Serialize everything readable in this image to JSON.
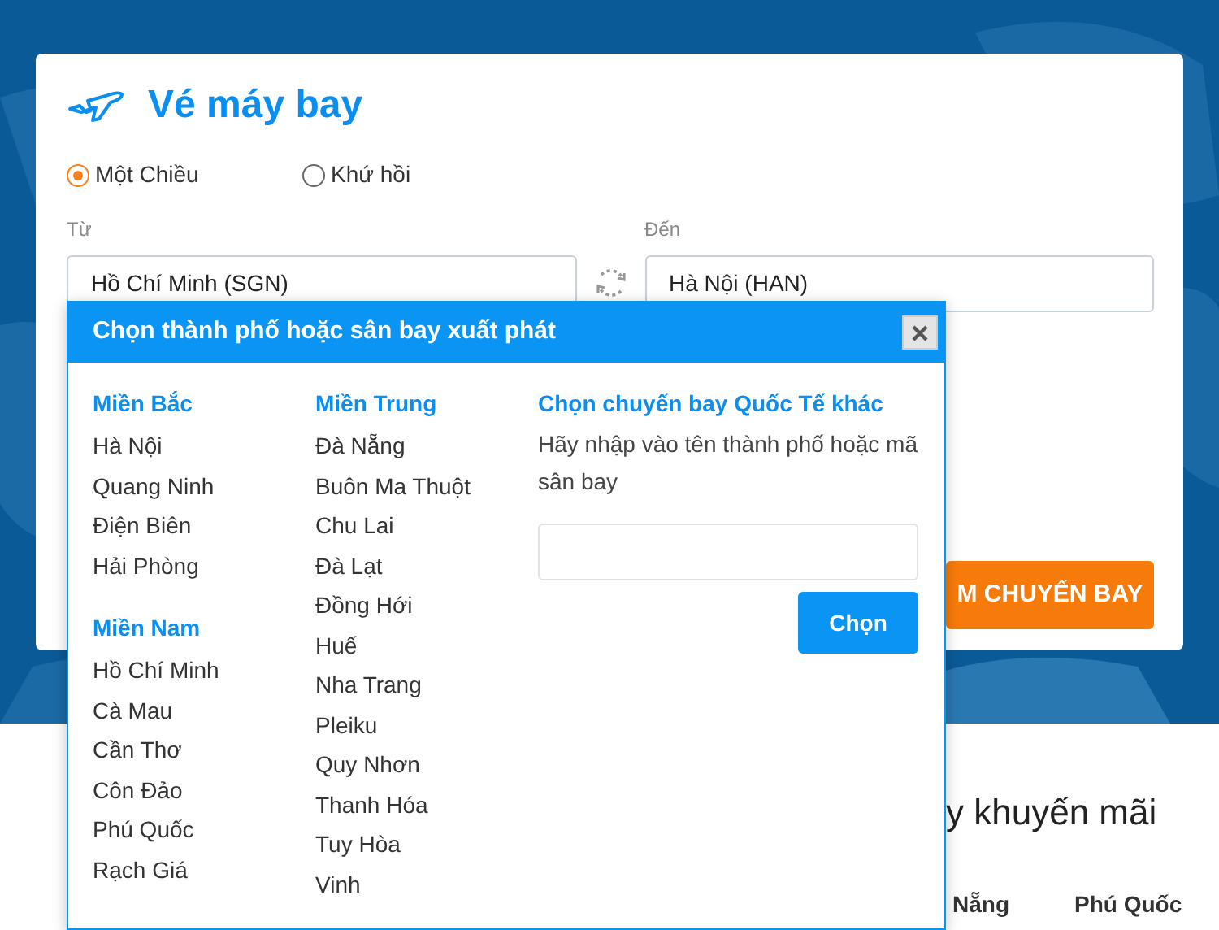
{
  "page_title": "Vé máy bay",
  "trip_types": [
    {
      "label": "Một Chiều",
      "selected": true
    },
    {
      "label": "Khứ hồi",
      "selected": false
    }
  ],
  "from": {
    "label": "Từ",
    "value": "Hồ Chí Minh (SGN)"
  },
  "to": {
    "label": "Đến",
    "value": "Hà Nội (HAN)"
  },
  "search_button": "M CHUYẾN BAY",
  "popup": {
    "title": "Chọn thành phố hoặc sân bay xuất phát",
    "columns": [
      {
        "groups": [
          {
            "region": "Miền Bắc",
            "cities": [
              "Hà Nội",
              "Quang Ninh",
              "Điện Biên",
              "Hải Phòng"
            ]
          },
          {
            "region": "Miền Nam",
            "cities": [
              "Hồ Chí Minh",
              "Cà Mau",
              "Cần Thơ",
              "Côn Đảo",
              "Phú Quốc",
              "Rạch Giá"
            ]
          }
        ]
      },
      {
        "groups": [
          {
            "region": "Miền Trung",
            "cities": [
              "Đà Nẵng",
              "Buôn Ma Thuột",
              "Chu Lai",
              "Đà Lạt",
              "Đồng Hới",
              "Huế",
              "Nha Trang",
              "Pleiku",
              "Quy Nhơn",
              "Thanh Hóa",
              "Tuy Hòa",
              "Vinh"
            ]
          }
        ]
      }
    ],
    "international": {
      "title": "Chọn chuyến bay Quốc Tế khác",
      "hint": "Hãy nhập vào tên thành phố hoặc mã sân bay",
      "button": "Chọn"
    }
  },
  "promo": {
    "heading": "y khuyến mãi",
    "tab_labels": [
      "Nẵng",
      "Phú Quốc"
    ]
  }
}
